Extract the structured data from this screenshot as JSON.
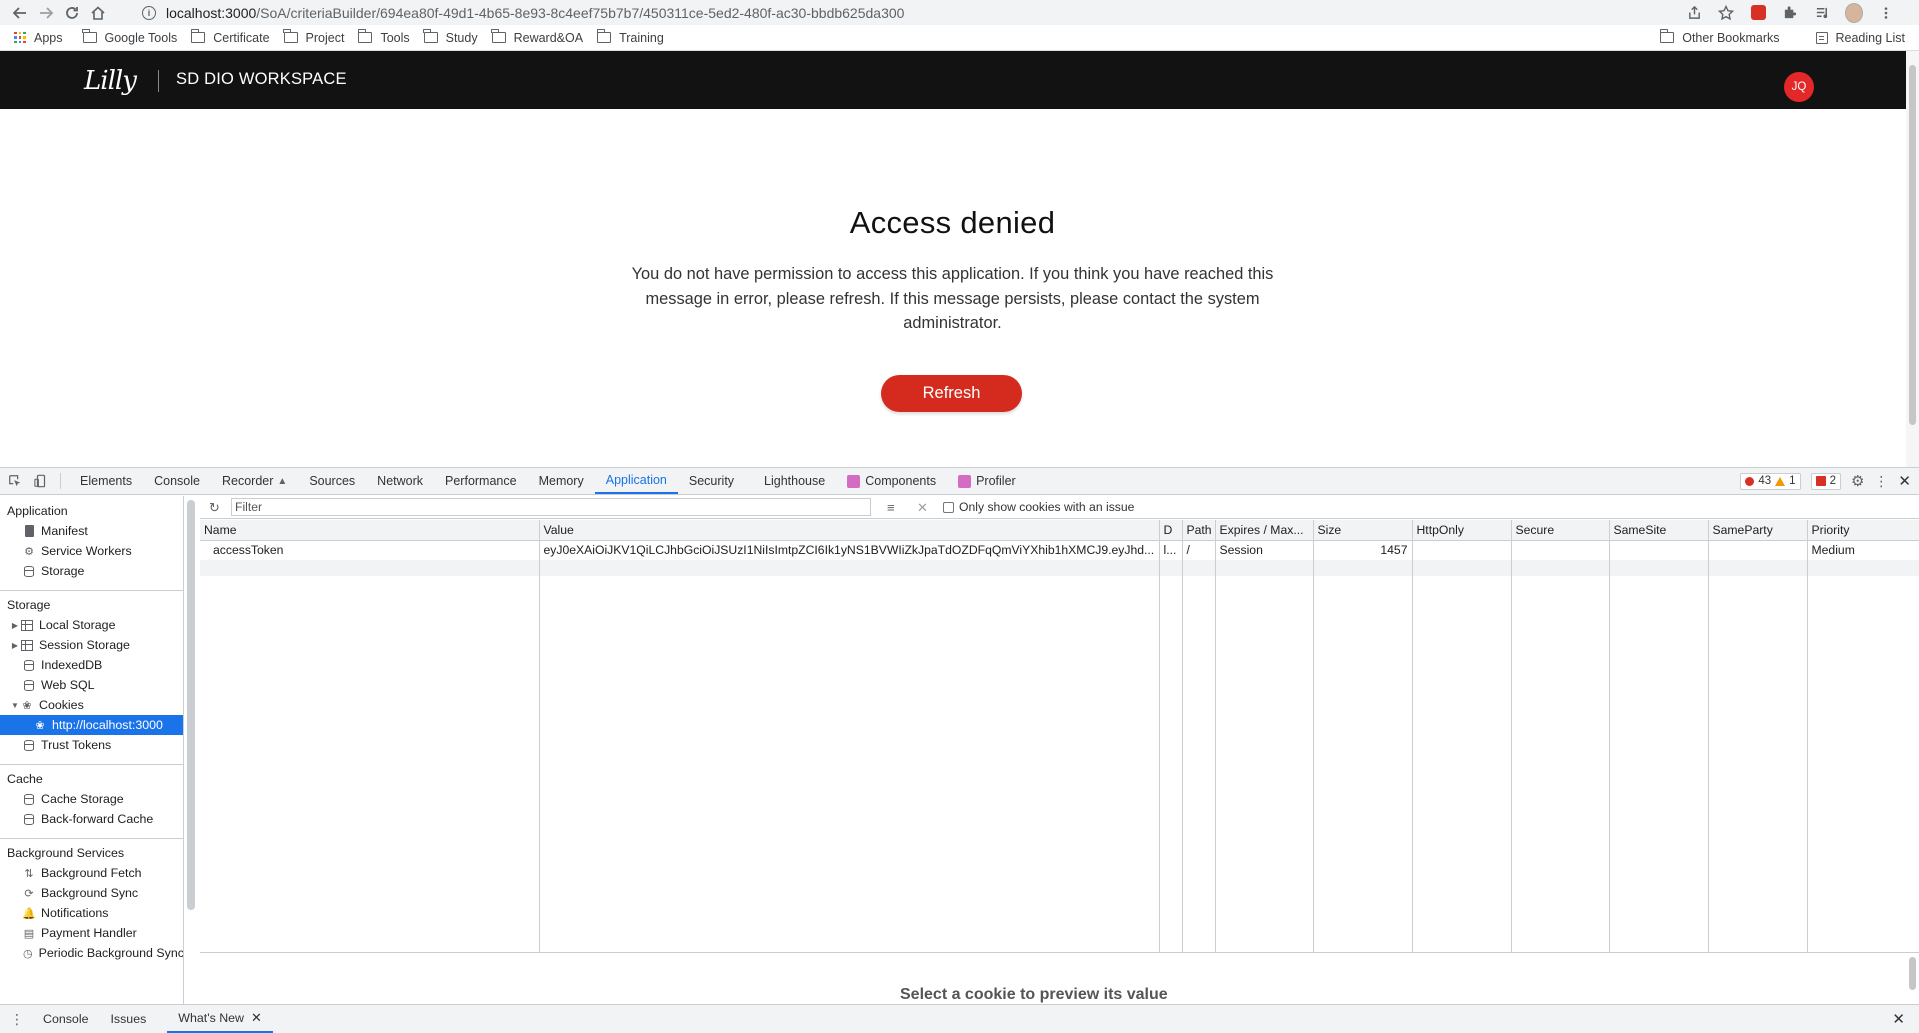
{
  "browser": {
    "url_host": "localhost:3000",
    "url_path": "/SoA/criteriaBuilder/694ea80f-49d1-4b65-8e93-8c4eef75b7b7/450311ce-5ed2-480f-ac30-bbdb625da300",
    "bookmarks": [
      "Apps",
      "Google Tools",
      "Certificate",
      "Project",
      "Tools",
      "Study",
      "Reward&OA",
      "Training"
    ],
    "bookmarks_right": [
      "Other Bookmarks",
      "Reading List"
    ]
  },
  "app": {
    "logo": "Lilly",
    "workspace_title": "SD DIO WORKSPACE",
    "user_initials": "JQ",
    "heading": "Access denied",
    "message": "You do not have permission to access this application. If you think you have reached this message in error, please refresh. If this message persists, please contact the system administrator.",
    "refresh_label": "Refresh",
    "accent_color": "#d52b1e"
  },
  "devtools": {
    "tabs": [
      "Elements",
      "Console",
      "Recorder",
      "Sources",
      "Network",
      "Performance",
      "Memory",
      "Application",
      "Security",
      "Lighthouse",
      "Components",
      "Profiler"
    ],
    "active_tab": "Application",
    "error_count": "43",
    "warning_count": "1",
    "issue_count": "2",
    "sidebar": {
      "application_label": "Application",
      "application_items": [
        "Manifest",
        "Service Workers",
        "Storage"
      ],
      "storage_label": "Storage",
      "storage_items": [
        "Local Storage",
        "Session Storage",
        "IndexedDB",
        "Web SQL",
        "Cookies"
      ],
      "cookie_origin": "http://localhost:3000",
      "trust_tokens": "Trust Tokens",
      "cache_label": "Cache",
      "cache_items": [
        "Cache Storage",
        "Back-forward Cache"
      ],
      "bg_label": "Background Services",
      "bg_items": [
        "Background Fetch",
        "Background Sync",
        "Notifications",
        "Payment Handler",
        "Periodic Background Sync"
      ]
    },
    "filter_placeholder": "Filter",
    "only_issues_label": "Only show cookies with an issue",
    "columns": [
      "Name",
      "Value",
      "D",
      "Path",
      "Expires / Max...",
      "Size",
      "HttpOnly",
      "Secure",
      "SameSite",
      "SameParty",
      "Priority"
    ],
    "cookies": [
      {
        "name": "accessToken",
        "value": "eyJ0eXAiOiJKV1QiLCJhbGciOiJSUzI1NiIsImtpZCI6Ik1yNS1BVWIiZkJpaTdOZDFqQmViYXhib1hXMCJ9.eyJhd...",
        "domain": "l...",
        "path": "/",
        "expires": "Session",
        "size": "1457",
        "httponly": "",
        "secure": "",
        "samesite": "",
        "sameparty": "",
        "priority": "Medium"
      }
    ],
    "preview_message": "Select a cookie to preview its value",
    "drawer_tabs": [
      "Console",
      "Issues",
      "What's New"
    ],
    "drawer_active": "What's New"
  }
}
